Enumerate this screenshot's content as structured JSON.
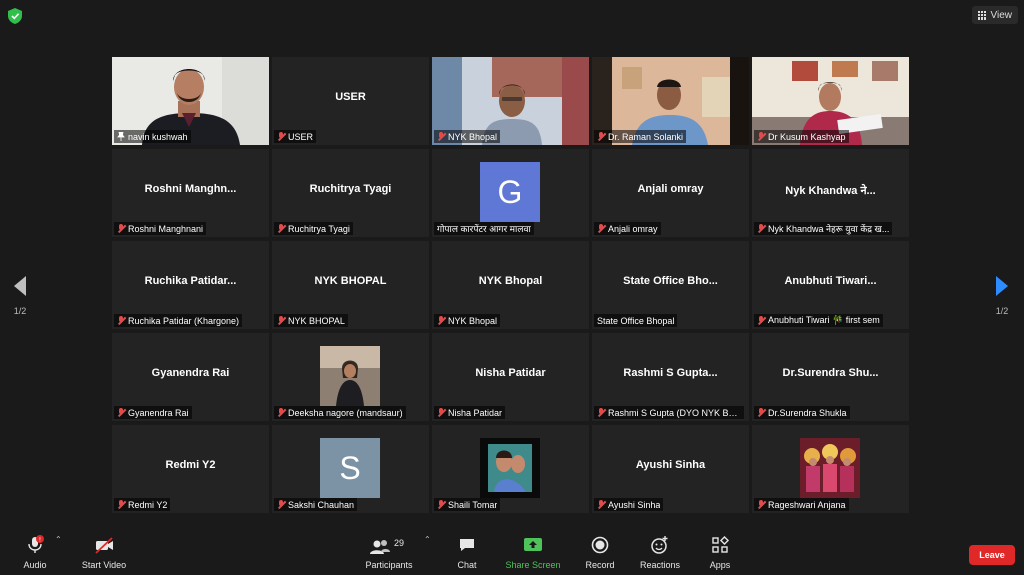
{
  "top": {
    "view_label": "View"
  },
  "nav": {
    "left_page": "1/2",
    "right_page": "1/2"
  },
  "tiles": [
    {
      "center": "",
      "label": "navin kushwah",
      "kind": "video1",
      "active": true,
      "pin": true
    },
    {
      "center": "USER",
      "label": "USER",
      "kind": "name"
    },
    {
      "center": "",
      "label": "NYK Bhopal",
      "kind": "video2"
    },
    {
      "center": "",
      "label": "Dr. Raman Solanki",
      "kind": "video3"
    },
    {
      "center": "",
      "label": "Dr Kusum Kashyap",
      "kind": "video4"
    },
    {
      "center": "Roshni  Manghn...",
      "label": "Roshni Manghnani",
      "kind": "name"
    },
    {
      "center": "Ruchitrya Tyagi",
      "label": "Ruchitrya Tyagi",
      "kind": "name"
    },
    {
      "center": "",
      "label": "गोपाल कारपेंटर आगर मालवा",
      "kind": "letter",
      "letter": "G",
      "color": "#5f78d6",
      "nomic": true
    },
    {
      "center": "Anjali omray",
      "label": "Anjali omray",
      "kind": "name"
    },
    {
      "center": "Nyk  Khandwa  ने...",
      "label": "Nyk Khandwa नेहरू युवा केंद्र ख...",
      "kind": "name"
    },
    {
      "center": "Ruchika  Patidar...",
      "label": "Ruchika Patidar (Khargone)",
      "kind": "name"
    },
    {
      "center": "NYK BHOPAL",
      "label": "NYK BHOPAL",
      "kind": "name"
    },
    {
      "center": "NYK Bhopal",
      "label": "NYK Bhopal",
      "kind": "name"
    },
    {
      "center": "State  Office  Bho...",
      "label": "State Office Bhopal",
      "kind": "name",
      "nomic": true
    },
    {
      "center": "Anubhuti  Tiwari...",
      "label": "Anubhuti Tiwari 🎋 first sem",
      "kind": "name"
    },
    {
      "center": "Gyanendra Rai",
      "label": "Gyanendra Rai",
      "kind": "name"
    },
    {
      "center": "",
      "label": "Deeksha nagore (mandsaur)",
      "kind": "photo1"
    },
    {
      "center": "Nisha Patidar",
      "label": "Nisha Patidar",
      "kind": "name"
    },
    {
      "center": "Rashmi  S  Gupta...",
      "label": "Rashmi S Gupta (DYO NYK Ba...",
      "kind": "name"
    },
    {
      "center": "Dr.Surendra  Shu...",
      "label": "Dr.Surendra Shukla",
      "kind": "name"
    },
    {
      "center": "Redmi Y2",
      "label": "Redmi Y2",
      "kind": "name"
    },
    {
      "center": "",
      "label": "Sakshi Chauhan",
      "kind": "letter",
      "letter": "S",
      "color": "#7c93a6"
    },
    {
      "center": "",
      "label": "Shaili Tomar",
      "kind": "photo2"
    },
    {
      "center": "Ayushi Sinha",
      "label": "Ayushi Sinha",
      "kind": "name"
    },
    {
      "center": "",
      "label": "Rageshwari Anjana",
      "kind": "photo3"
    }
  ],
  "toolbar": {
    "audio": "Audio",
    "audio_badge": "!",
    "start_video": "Start Video",
    "participants": "Participants",
    "participants_count": "29",
    "chat": "Chat",
    "share_screen": "Share Screen",
    "record": "Record",
    "reactions": "Reactions",
    "apps": "Apps",
    "leave": "Leave"
  },
  "colors": {
    "accent": "#2d8cff",
    "share_green": "#4ec35a",
    "leave_red": "#e02828",
    "active_border": "#d7e05b"
  }
}
